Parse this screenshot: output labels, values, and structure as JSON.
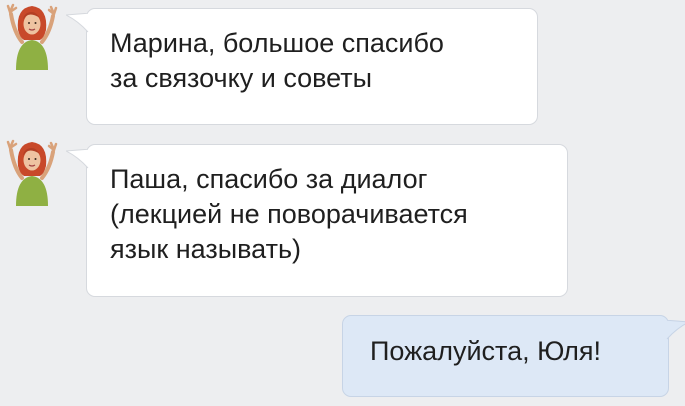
{
  "messages": [
    {
      "direction": "incoming",
      "sender_avatar": "woman-avatar",
      "lines": [
        "Марина, большое спасибо",
        "за связочку и советы"
      ]
    },
    {
      "direction": "incoming",
      "sender_avatar": "woman-avatar",
      "lines": [
        "Паша, спасибо за диалог",
        "(лекцией не поворачивается",
        "язык называть)"
      ]
    },
    {
      "direction": "outgoing",
      "lines": [
        "Пожалуйста, Юля!"
      ]
    }
  ],
  "colors": {
    "background": "#edeef0",
    "incoming_bubble": "#ffffff",
    "outgoing_bubble": "#dde8f6",
    "text": "#1f1f1f",
    "avatar_hair": "#c8492a",
    "avatar_shirt": "#8fb043"
  }
}
